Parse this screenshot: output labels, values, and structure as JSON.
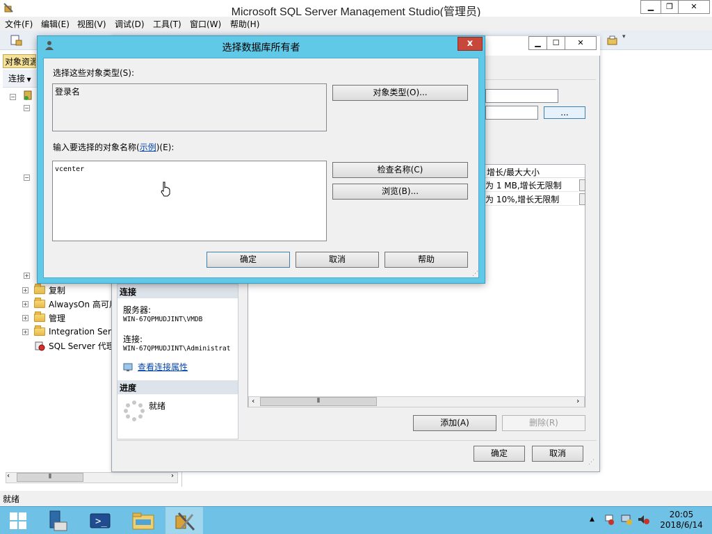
{
  "app": {
    "title": "Microsoft SQL Server Management Studio(管理员)",
    "window_buttons": {
      "minimize": "▁",
      "restore": "❐",
      "close": "✕"
    }
  },
  "menu": [
    "文件(F)",
    "编辑(E)",
    "视图(V)",
    "调试(D)",
    "工具(T)",
    "窗口(W)",
    "帮助(H)"
  ],
  "object_explorer": {
    "header": "对象资源",
    "connect_label": "连接",
    "tree_items": [
      "复制",
      "AlwaysOn 高可用",
      "管理",
      "Integration Serv",
      "SQL Server 代理"
    ],
    "scroll_thumb": "⦀"
  },
  "properties_window": {
    "connection_section": "连接",
    "server_label": "服务器:",
    "server_value": "WIN-67QPMUDJINT\\VMDB",
    "connection_label": "连接:",
    "connection_value": "WIN-67QPMUDJINT\\Administrat",
    "view_connection_link": "查看连接属性",
    "progress_section": "进度",
    "progress_status": "就绪",
    "browse_button": "...",
    "grid_header": "增长/最大大小",
    "grid_rows": [
      "为 1 MB,增长无限制",
      "为 10%,增长无限制"
    ],
    "add_button": "添加(A)",
    "remove_button": "删除(R)",
    "ok_button": "确定",
    "cancel_button": "取消",
    "scroll_thumb": "⦀"
  },
  "dialog": {
    "title": "选择数据库所有者",
    "object_types_label": "选择这些对象类型(S):",
    "object_types_value": "登录名",
    "object_types_button": "对象类型(O)...",
    "names_label_prefix": "输入要选择的对象名称(",
    "names_label_link": "示例",
    "names_label_suffix": ")(E):",
    "names_value": "vcenter",
    "check_names_button": "检查名称(C)",
    "browse_button": "浏览(B)...",
    "ok_button": "确定",
    "cancel_button": "取消",
    "help_button": "帮助",
    "close": "x"
  },
  "status_bar": {
    "text": "就绪"
  },
  "taskbar": {
    "time": "20:05",
    "date": "2018/6/14"
  }
}
